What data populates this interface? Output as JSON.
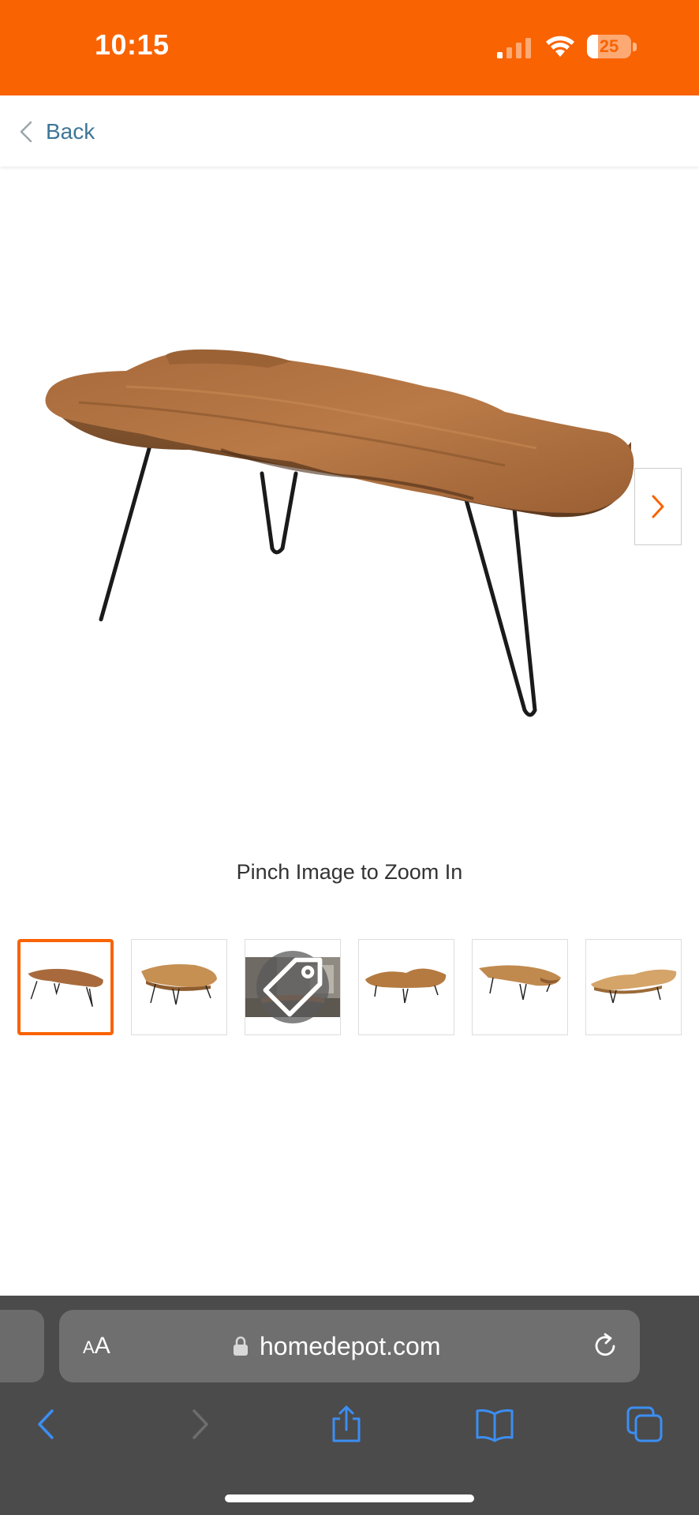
{
  "status_bar": {
    "time": "10:15",
    "battery_level": "25",
    "battery_fraction": 0.25,
    "signal_bars_active": 1,
    "background_color": "#f96302"
  },
  "nav": {
    "back_label": "Back",
    "back_icon": "chevron-left-icon",
    "link_color": "#3e7697"
  },
  "gallery": {
    "next_icon": "chevron-right-icon",
    "zoom_hint": "Pinch Image to Zoom In",
    "active_thumbnail_index": 0,
    "accent_color": "#f96302",
    "thumbnails": [
      {
        "name": "thumbnail-1",
        "kind": "image",
        "selected": true
      },
      {
        "name": "thumbnail-2",
        "kind": "image",
        "selected": false
      },
      {
        "name": "thumbnail-3",
        "kind": "video",
        "overlay_icon": "tag-icon",
        "selected": false
      },
      {
        "name": "thumbnail-4",
        "kind": "image",
        "selected": false
      },
      {
        "name": "thumbnail-5",
        "kind": "image",
        "selected": false
      },
      {
        "name": "thumbnail-6",
        "kind": "image",
        "selected": false
      }
    ]
  },
  "browser": {
    "text_size_small": "A",
    "text_size_large": "A",
    "url": "homedepot.com",
    "lock_icon": "lock-icon",
    "reload_icon": "reload-icon",
    "toolbar_icons": [
      "back-icon",
      "forward-icon",
      "share-icon",
      "bookmarks-icon",
      "tabs-icon"
    ]
  }
}
